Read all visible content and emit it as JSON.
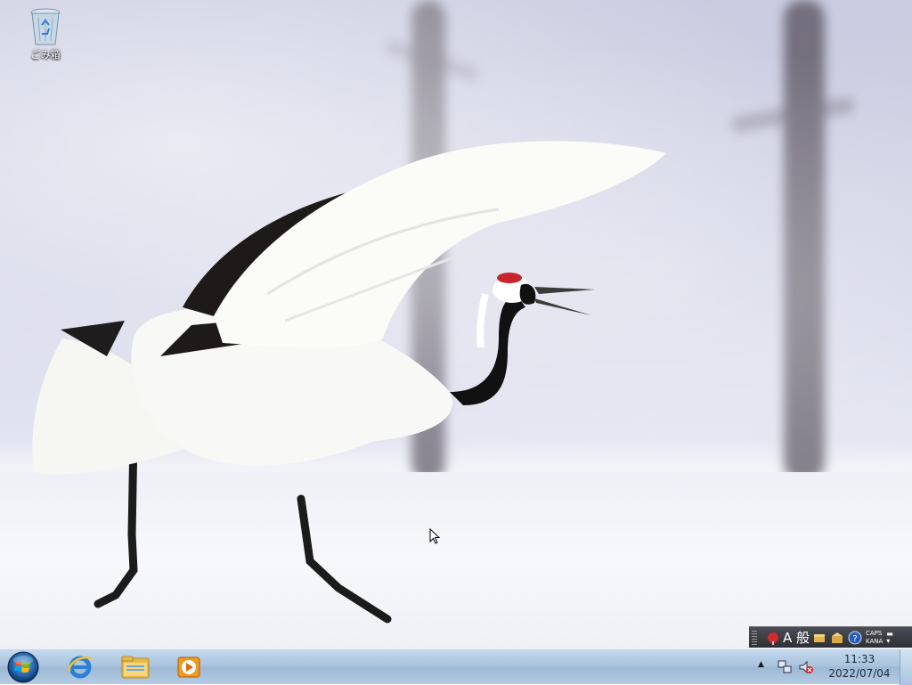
{
  "desktop": {
    "recycle_bin": {
      "label": "ごみ箱",
      "icon": "recycle-bin-icon"
    }
  },
  "language_bar": {
    "ime_mode": "A 般",
    "caps_label": "CAPS",
    "kana_label": "KANA",
    "icons": [
      "ime-pad-icon",
      "dictionary-icon",
      "tool-icon",
      "help-icon"
    ]
  },
  "taskbar": {
    "start": {
      "icon": "windows-start-orb-icon"
    },
    "pinned": [
      {
        "name": "internet-explorer",
        "icon": "internet-explorer-icon"
      },
      {
        "name": "windows-explorer",
        "icon": "folder-icon"
      },
      {
        "name": "windows-media-player",
        "icon": "media-player-icon"
      }
    ],
    "tray": {
      "show_hidden_glyph": "▲",
      "time": "11:33",
      "date": "2022/07/04"
    }
  },
  "colors": {
    "taskbar_top": "#c4d9ec",
    "taskbar_bottom": "#9db8d5",
    "crane_crown": "#c9232b"
  }
}
